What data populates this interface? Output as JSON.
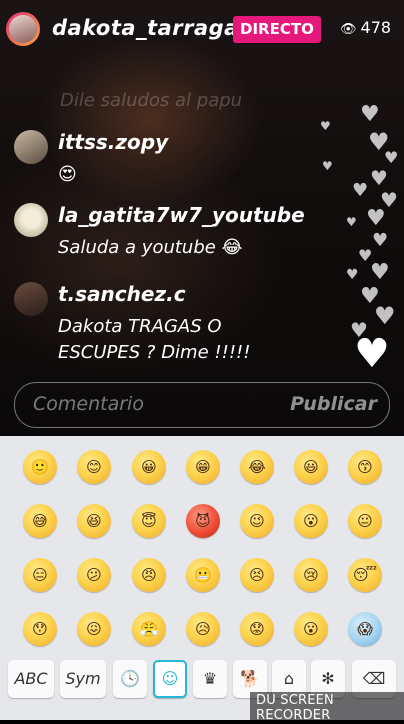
{
  "header": {
    "username": "dakota_tarraga",
    "live_badge": "DIRECTO",
    "viewer_icon": "eye-icon",
    "viewer_count": "478"
  },
  "comments": [
    {
      "username": "ittss.zopy",
      "message": "😍"
    },
    {
      "username": "la_gatita7w7_youtube",
      "message": "Saluda a youtube 😂"
    },
    {
      "username": "t.sanchez.c",
      "message_line1": "Dakota TRAGAS O",
      "message_line2": "ESCUPES ? Dime !!!!!"
    }
  ],
  "faded_comment": "Dile saludos al papu",
  "input": {
    "placeholder": "Comentario",
    "post_label": "Publicar"
  },
  "keyboard": {
    "emojis": [
      "🙂",
      "😊",
      "😀",
      "😁",
      "😂",
      "😃",
      "😙",
      "😅",
      "😆",
      "😇",
      "😈",
      "😉",
      "😮",
      "😐",
      "😑",
      "😕",
      "😠",
      "😬",
      "😣",
      "😢",
      "😴",
      "😯",
      "😖",
      "😤",
      "😥",
      "😟",
      "😮",
      "😱"
    ],
    "toolbar": {
      "abc_label": "ABC",
      "sym_label": "Sym",
      "icons": [
        "clock-icon",
        "smiley-icon",
        "crown-icon",
        "dog-icon",
        "home-icon",
        "flower-icon",
        "backspace-icon"
      ]
    }
  },
  "watermark": "DU SCREEN RECORDER",
  "colors": {
    "live_badge": "#e4197b",
    "selected_tab_border": "#28b7d5",
    "keyboard_bg": "#e6e7ea"
  }
}
